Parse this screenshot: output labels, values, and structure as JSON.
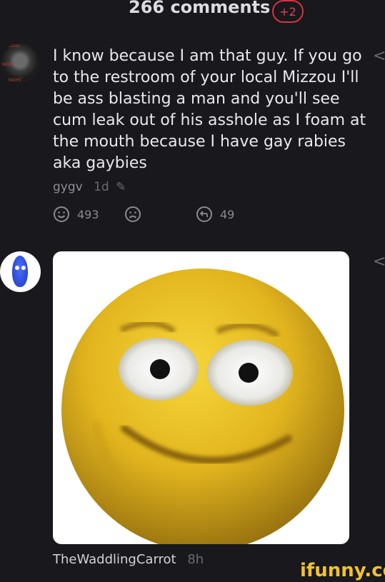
{
  "header": {
    "title": "266 comments",
    "new_badge": "+2"
  },
  "comment1": {
    "avatar_text_top": "Mizzou",
    "avatar_text_mid": "NIGHT",
    "avatar_tag": "NIGHT",
    "text": "I know because I am that guy. If you go to the restroom of your local Mizzou I'll be ass blasting a man and you'll see cum leak out of his asshole as I foam at the mouth because I have gay rabies aka gaybies",
    "username": "gygv",
    "time": "1d",
    "edited_icon": "pencil-icon",
    "likes": "493",
    "replies": "49",
    "reply_arrow": "<"
  },
  "comment2": {
    "username": "TheWaddlingCarrot",
    "time": "8h",
    "image": "smiling-yellow-emoji-face",
    "reply_arrow": "<"
  },
  "watermark": "ifunny.co",
  "colors": {
    "background": "#18181d",
    "badge": "#d8333d",
    "watermark": "#f2c12e"
  }
}
